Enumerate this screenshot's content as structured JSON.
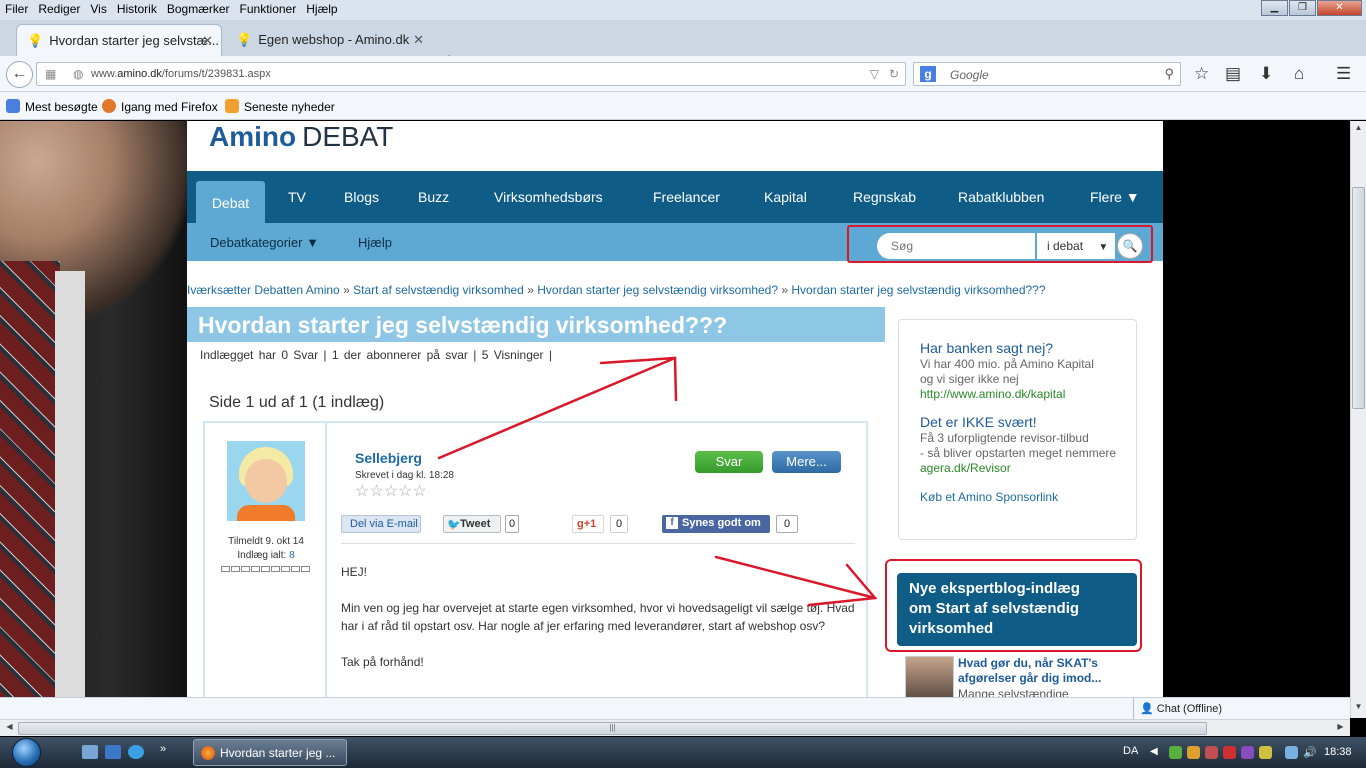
{
  "menubar": {
    "items": [
      "Filer",
      "Rediger",
      "Vis",
      "Historik",
      "Bogmærker",
      "Funktioner",
      "Hjælp"
    ]
  },
  "tabs": [
    {
      "label": "Hvordan starter jeg selvstæ..."
    },
    {
      "label": "Egen webshop - Amino.dk"
    }
  ],
  "navbar": {
    "url_prefix": "www.",
    "url_domain": "amino.dk",
    "url_path": "/forums/t/239831.aspx",
    "search_placeholder": "Google"
  },
  "bookmarks": [
    "Mest besøgte",
    "Igang med Firefox",
    "Seneste nyheder"
  ],
  "site": {
    "logo_main": "Amino",
    "logo_sub": "DEBAT",
    "main_nav": [
      "Debat",
      "TV",
      "Blogs",
      "Buzz",
      "Virksomhedsbørs",
      "Freelancer",
      "Kapital",
      "Regnskab",
      "Rabatklubben",
      "Flere ▼"
    ],
    "sub_nav": [
      "Debatkategorier ▼",
      "Hjælp"
    ],
    "search_placeholder": "Søg",
    "search_scope": "i debat",
    "breadcrumbs": [
      "Iværksætter Debatten Amino",
      "Start af selvstændig virksomhed",
      "Hvordan starter jeg selvstændig virksomhed?",
      "Hvordan starter jeg selvstændig virksomhed???"
    ],
    "breadcrumb_sep": "»",
    "thread_title": "Hvordan starter jeg selvstændig virksomhed???",
    "stats": "Indlægget har  0  Svar  |  1  der abonnerer på svar  |  5  Visninger  |",
    "page_info": "Side 1 ud af 1 (1 indlæg)"
  },
  "post": {
    "joined": "Tilmeldt 9. okt 14",
    "posts_label": "Indlæg ialt:",
    "posts_count": "8",
    "author": "Sellebjerg",
    "written": "Skrevet i dag kl. 18:28",
    "stars": "☆☆☆☆☆",
    "reply_label": "Svar",
    "more_label": "Mere...",
    "share_email": "Del via E-mail",
    "tweet_label": "Tweet",
    "tweet_count": "0",
    "gplus_label": "g+1",
    "gplus_count": "0",
    "fb_label": "Synes godt om",
    "fb_count": "0",
    "body": [
      "HEJ!",
      "Min ven og jeg har overvejet at starte egen virksomhed, hvor vi hovedsageligt vil sælge tøj. Hvad har i af råd til opstart osv. Har nogle af jer erfaring med leverandører, start af webshop osv?",
      "Tak på forhånd!"
    ]
  },
  "sponsor": {
    "ad1_title": "Har banken sagt nej?",
    "ad1_text1": "Vi har 400 mio. på Amino Kapital",
    "ad1_text2": "og vi siger ikke nej",
    "ad1_link": "http://www.amino.dk/kapital",
    "ad2_title": "Det er IKKE svært!",
    "ad2_text1": "Få 3 uforpligtende revisor-tilbud",
    "ad2_text2": "- så bliver opstarten meget nemmere",
    "ad2_link": "agera.dk/Revisor",
    "buy_link": "Køb et Amino Sponsorlink"
  },
  "expert": {
    "heading_line1": "Nye ekspertblog-indlæg",
    "heading_line2": "om  Start af selvstændig",
    "heading_line3": "virksomhed",
    "item_title_line1": "Hvad gør du, når SKAT's",
    "item_title_line2": "afgørelser går dig imod...",
    "item_desc": "Mange selvstændige"
  },
  "addon": {
    "chat": "Chat (Offline)"
  },
  "taskbar": {
    "task": "Hvordan starter jeg ...",
    "lang": "DA",
    "time": "18:38"
  },
  "colors": {
    "nav_dark": "#0f5d87",
    "nav_light": "#5ea9d3",
    "title_bar": "#8ec7e6",
    "annotation_red": "#d9182b"
  }
}
